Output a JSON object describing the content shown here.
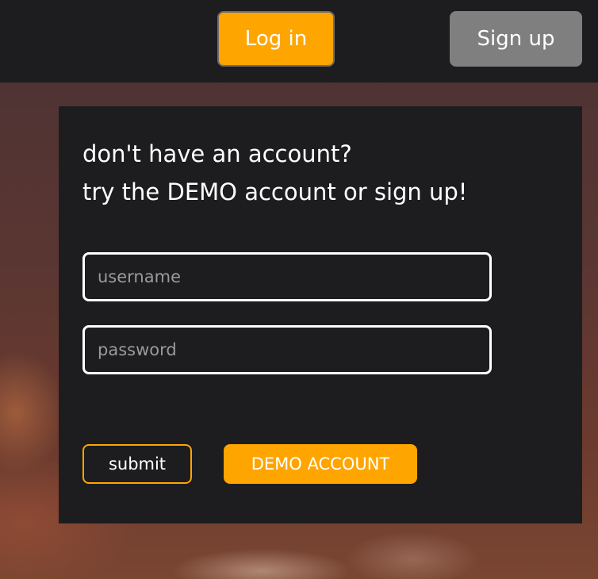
{
  "header": {
    "login_label": "Log in",
    "signup_label": "Sign up"
  },
  "form": {
    "heading_line1": "don't have an account?",
    "heading_line2": "try the DEMO account or sign up!",
    "username_placeholder": "username",
    "username_value": "",
    "password_placeholder": "password",
    "password_value": "",
    "submit_label": "submit",
    "demo_label": "DEMO ACCOUNT"
  },
  "colors": {
    "accent": "#ffa500",
    "panel": "#1d1d1f",
    "secondary_button": "#7f7f7f",
    "text": "#ffffff"
  }
}
